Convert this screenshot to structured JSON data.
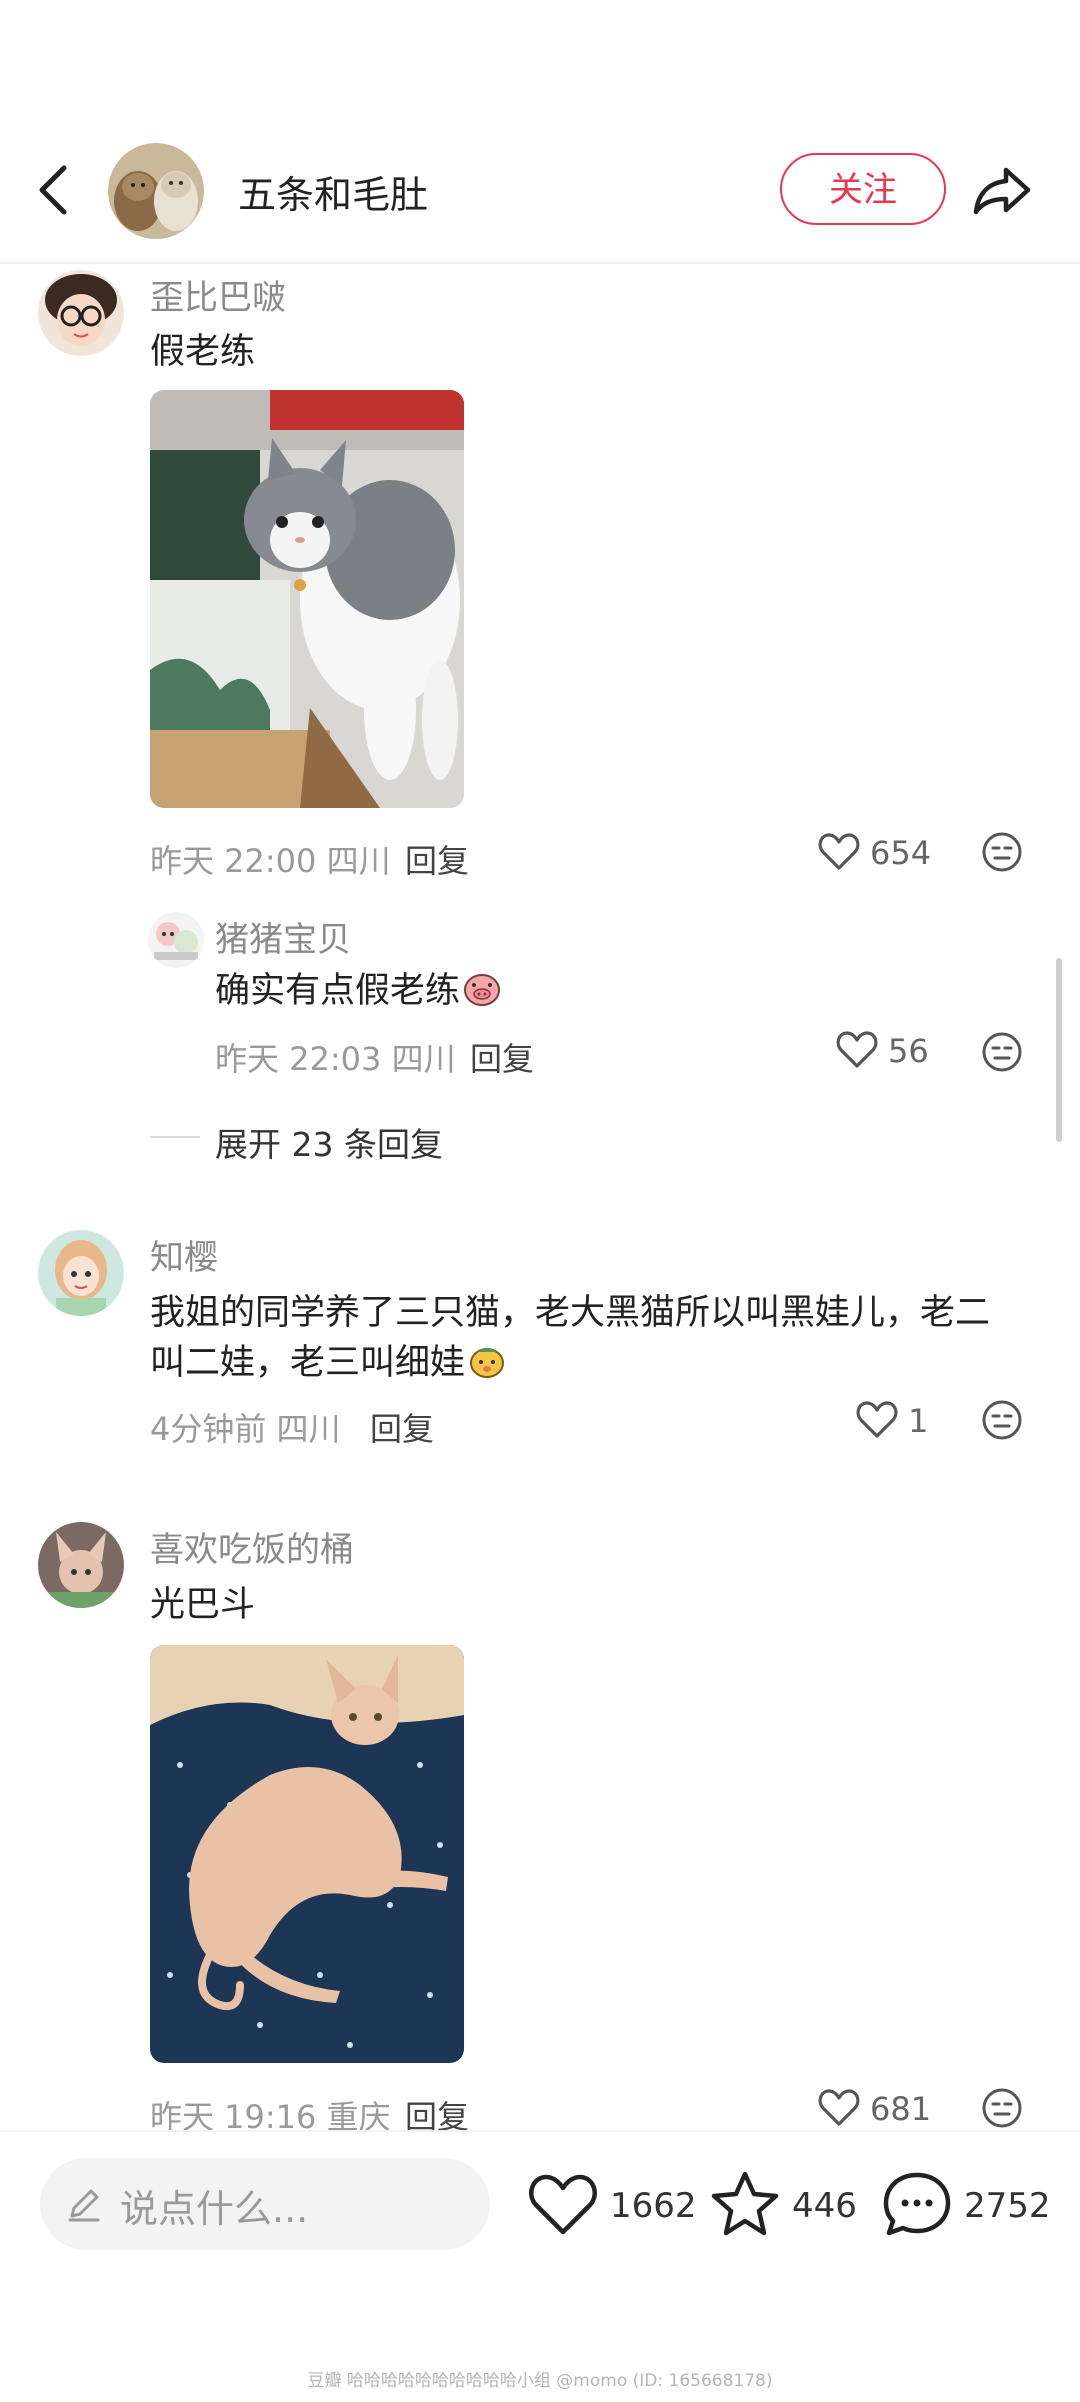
{
  "header": {
    "title": "五条和毛肚",
    "follow_label": "关注"
  },
  "comments": [
    {
      "user": "歪比巴啵",
      "text": "假老练",
      "meta": "昨天 22:00 四川",
      "reply_label": "回复",
      "likes": "654",
      "sub_reply": {
        "user": "猪猪宝贝",
        "text": "确实有点假老练",
        "meta": "昨天 22:03 四川",
        "reply_label": "回复",
        "likes": "56"
      },
      "expand_label": "展开 23 条回复"
    },
    {
      "user": "知樱",
      "text_line1": "我姐的同学养了三只猫，老大黑猫所以叫黑娃儿，老二",
      "text_line2": "叫二娃，老三叫细娃",
      "meta": "4分钟前 四川",
      "reply_label": "回复",
      "likes": "1"
    },
    {
      "user": "喜欢吃饭的桶",
      "text": "光巴斗",
      "meta": "昨天 19:16 重庆",
      "reply_label": "回复",
      "likes": "681"
    }
  ],
  "bottom_bar": {
    "input_placeholder": "说点什么...",
    "likes": "1662",
    "favorites": "446",
    "comments": "2752"
  },
  "watermark": "豆瓣  哈哈哈哈哈哈哈哈哈哈小组 @momo (ID: 165668178)",
  "colors": {
    "accent": "#e6394f",
    "meta_text": "#9a9a9a"
  },
  "icons": [
    "back-arrow-icon",
    "share-icon",
    "heart-icon",
    "emoji-icon",
    "pencil-icon",
    "star-icon",
    "comment-bubble-icon"
  ]
}
